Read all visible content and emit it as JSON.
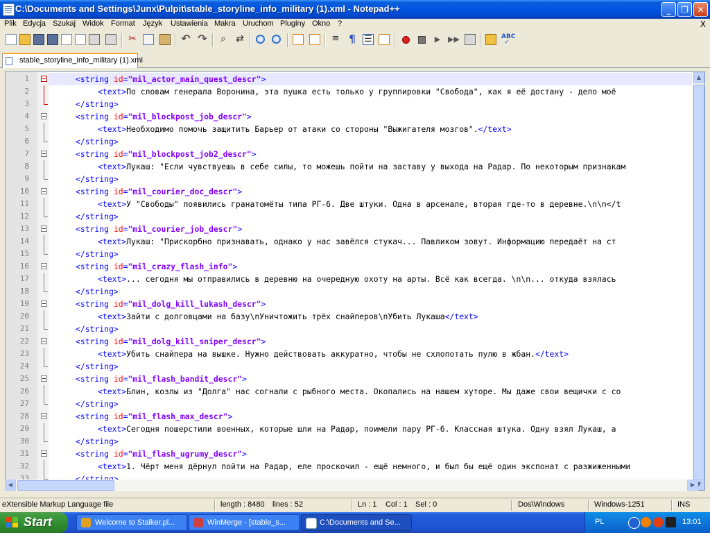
{
  "window": {
    "title": "C:\\Documents and Settings\\Junx\\Pulpit\\stable_storyline_info_military (1).xml - Notepad++",
    "minimize": "_",
    "maximize": "❐",
    "close": "✕"
  },
  "menu": {
    "items": [
      "Plik",
      "Edycja",
      "Szukaj",
      "Widok",
      "Format",
      "Język",
      "Ustawienia",
      "Makra",
      "Uruchom",
      "Pluginy",
      "Okno",
      "?"
    ],
    "close_x": "X"
  },
  "toolbar": {
    "icons": [
      "new-file-icon",
      "open-file-icon",
      "save-icon",
      "save-all-icon",
      "close-icon",
      "close-all-icon",
      "print-icon",
      "cut-icon",
      "copy-icon",
      "paste-icon",
      "undo-icon",
      "redo-icon",
      "find-icon",
      "replace-icon",
      "zoom-in-icon",
      "zoom-out-icon",
      "sync-v-icon",
      "sync-h-icon",
      "wrap-icon",
      "show-all-chars-icon",
      "indent-guide-icon",
      "function-list-icon",
      "record-macro-icon",
      "stop-macro-icon",
      "play-macro-icon",
      "play-multiple-icon",
      "save-macro-icon",
      "open-folder-icon",
      "spellcheck-icon"
    ]
  },
  "tabs": [
    {
      "label": "stable_storyline_info_military (1).xml",
      "active": true
    }
  ],
  "editor": {
    "lines": [
      {
        "n": "1",
        "kind": "open",
        "id": "mil_actor_main_quest_descr"
      },
      {
        "n": "2",
        "kind": "text",
        "content": "По словам генерала Воронина, эта пушка есть только у группировки \"Свобода\", как я её достану - дело моё"
      },
      {
        "n": "3",
        "kind": "close"
      },
      {
        "n": "4",
        "kind": "open",
        "id": "mil_blockpost_job_descr"
      },
      {
        "n": "5",
        "kind": "text",
        "content": "Необходимо помочь защитить Барьер от атаки со стороны \"Выжигателя мозгов\".",
        "closed": true
      },
      {
        "n": "6",
        "kind": "close"
      },
      {
        "n": "7",
        "kind": "open",
        "id": "mil_blockpost_job2_descr"
      },
      {
        "n": "8",
        "kind": "text",
        "content": "Лукаш: \"Если чувствуешь в себе силы, то можешь пойти на заставу у выхода на Радар. По некоторым признакам"
      },
      {
        "n": "9",
        "kind": "close"
      },
      {
        "n": "10",
        "kind": "open",
        "id": "mil_courier_doc_descr"
      },
      {
        "n": "11",
        "kind": "text",
        "content": "У \"Свободы\" появились гранатомёты типа РГ-6. Две штуки. Одна в арсенале, вторая где-то в деревне.\\n\\n</t"
      },
      {
        "n": "12",
        "kind": "close"
      },
      {
        "n": "13",
        "kind": "open",
        "id": "mil_courier_job_descr"
      },
      {
        "n": "14",
        "kind": "text",
        "content": "Лукаш: \"Прискорбно признавать, однако у нас завёлся стукач... Павликом зовут. Информацию передаёт на ст"
      },
      {
        "n": "15",
        "kind": "close"
      },
      {
        "n": "16",
        "kind": "open",
        "id": "mil_crazy_flash_info"
      },
      {
        "n": "17",
        "kind": "text",
        "content": "... сегодня мы отправились в деревню на очередную охоту на арты. Всё как всегда. \\n\\n... откуда взялась"
      },
      {
        "n": "18",
        "kind": "close"
      },
      {
        "n": "19",
        "kind": "open",
        "id": "mil_dolg_kill_lukash_descr"
      },
      {
        "n": "20",
        "kind": "text",
        "content": "Зайти с долговцами на базу\\nУничтожить трёх снайперов\\nУбить Лукаша",
        "closed": true
      },
      {
        "n": "21",
        "kind": "close"
      },
      {
        "n": "22",
        "kind": "open",
        "id": "mil_dolg_kill_sniper_descr"
      },
      {
        "n": "23",
        "kind": "text",
        "content": "Убить снайпера на вышке. Нужно действовать аккуратно, чтобы не схлопотать пулю в жбан.",
        "closed": true
      },
      {
        "n": "24",
        "kind": "close"
      },
      {
        "n": "25",
        "kind": "open",
        "id": "mil_flash_bandit_descr"
      },
      {
        "n": "26",
        "kind": "text",
        "content": "Блин, козлы из \"Долга\" нас согнали с рыбного места. Окопались на нашем хуторе. Мы даже свои вещички с со"
      },
      {
        "n": "27",
        "kind": "close"
      },
      {
        "n": "28",
        "kind": "open",
        "id": "mil_flash_max_descr"
      },
      {
        "n": "29",
        "kind": "text",
        "content": "Сегодня пошерстили военных, которые шли на Радар, поимели пару РГ-6. Классная штука. Одну взял Лукаш, а"
      },
      {
        "n": "30",
        "kind": "close"
      },
      {
        "n": "31",
        "kind": "open",
        "id": "mil_flash_ugrumy_descr"
      },
      {
        "n": "32",
        "kind": "text",
        "content": "1. Чёрт меня дёрнул пойти на Радар, еле проскочил - ещё немного, и был бы ещё один экспонат с разжиженными"
      },
      {
        "n": "33",
        "kind": "close"
      }
    ]
  },
  "status": {
    "file_type": "eXtensible Markup Language file",
    "length": "length : 8480",
    "lines": "lines : 52",
    "ln": "Ln : 1",
    "col": "Col : 1",
    "sel": "Sel : 0",
    "eol": "Dos\\Windows",
    "encoding": "Windows-1251",
    "mode": "INS"
  },
  "taskbar": {
    "start": "Start",
    "tasks": [
      {
        "label": "Welcome to Stalker.pl...",
        "icon_color": "#e0a020"
      },
      {
        "label": "WinMerge - [stable_s...",
        "icon_color": "#d04040"
      },
      {
        "label": "C:\\Documents and Se...",
        "icon_color": "#ffffff",
        "active": true
      }
    ],
    "tray": {
      "lang": "PL",
      "clock": "13:01"
    }
  },
  "colors": {
    "tag": "#0000ff",
    "attribute": "#ff0000",
    "attribute_value": "#8000ff",
    "current_line": "#e8e8ff",
    "fold_active": "#d00000"
  }
}
